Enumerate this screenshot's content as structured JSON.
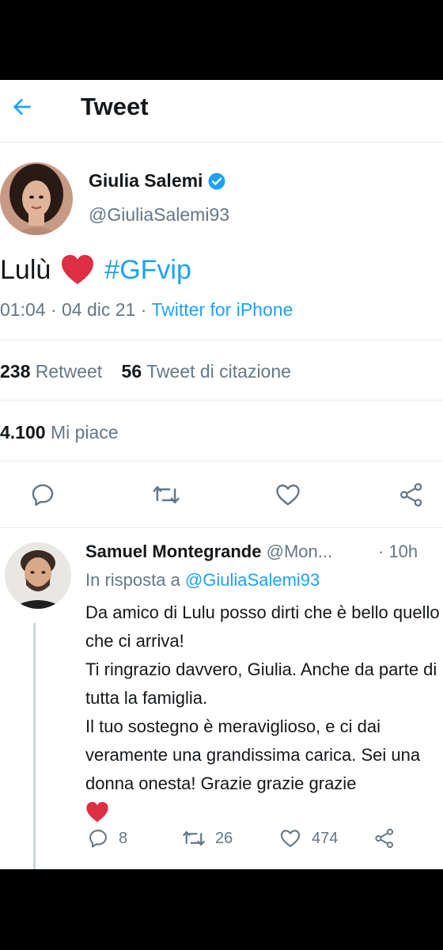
{
  "header": {
    "title": "Tweet"
  },
  "tweet": {
    "author_name": "Giulia Salemi",
    "author_handle": "@GiuliaSalemi93",
    "text_prefix": "Lulù",
    "hashtag": "#GFvip",
    "time": "01:04 · 04 dic 21 · ",
    "source": "Twitter for iPhone",
    "retweets_count": "238",
    "retweets_label": "Retweet",
    "quotes_count": "56",
    "quotes_label": "Tweet di citazione",
    "likes_count": "4.100",
    "likes_label": "Mi piace"
  },
  "reply": {
    "author_name": "Samuel Montegrande",
    "author_handle": "@Mon...",
    "time": "· 10h",
    "in_reply_prefix": "In risposta a ",
    "in_reply_mention": "@GiuliaSalemi93",
    "lines": [
      "Da amico di Lulu posso dirti che è bello quello che ci arriva!",
      "Ti ringrazio davvero, Giulia. Anche da parte di tutta la famiglia.",
      "Il tuo sostegno è meraviglioso, e ci dai veramente una grandissima carica. Sei una donna onesta! Grazie grazie grazie"
    ],
    "replies_count": "8",
    "retweets_count": "26",
    "likes_count": "474"
  },
  "colors": {
    "accent": "#1da1f2",
    "heart": "#dd2e44",
    "text": "#14171a",
    "muted": "#657786"
  },
  "icons": [
    "back-arrow-icon",
    "verified-icon",
    "reply-icon",
    "retweet-icon",
    "like-icon",
    "share-icon",
    "heart-emoji-icon"
  ]
}
